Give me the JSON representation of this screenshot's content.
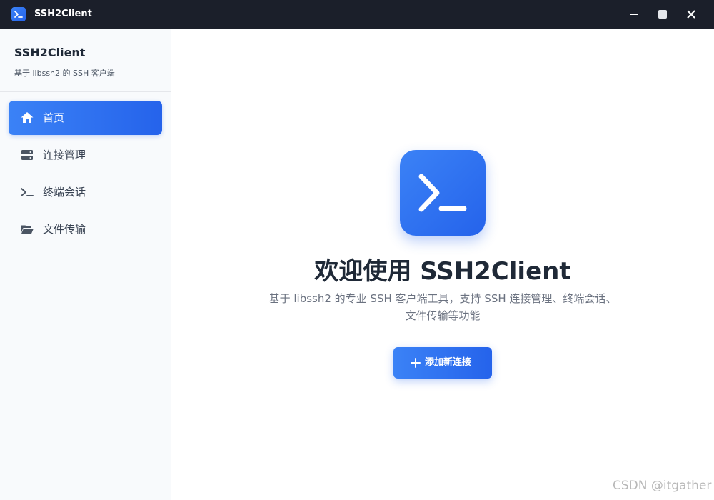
{
  "window": {
    "title": "SSH2Client"
  },
  "sidebar": {
    "brand_name": "SSH2Client",
    "brand_subtitle": "基于 libssh2 的 SSH 客户端",
    "items": [
      {
        "label": "首页",
        "icon": "home-icon",
        "active": true
      },
      {
        "label": "连接管理",
        "icon": "server-icon",
        "active": false
      },
      {
        "label": "终端会话",
        "icon": "terminal-icon",
        "active": false
      },
      {
        "label": "文件传输",
        "icon": "folder-icon",
        "active": false
      }
    ]
  },
  "main": {
    "title": "欢迎使用 SSH2Client",
    "description_line1": "基于 libssh2 的专业 SSH 客户端工具，支持 SSH 连接管理、终端会话、",
    "description_line2": "文件传输等功能",
    "add_button_label": "添加新连接"
  },
  "watermark": "CSDN @itgather",
  "colors": {
    "accent": "#3b82f6",
    "accent_dark": "#2563eb",
    "titlebar": "#1b1f2a",
    "sidebar_bg": "#f8fafc"
  }
}
